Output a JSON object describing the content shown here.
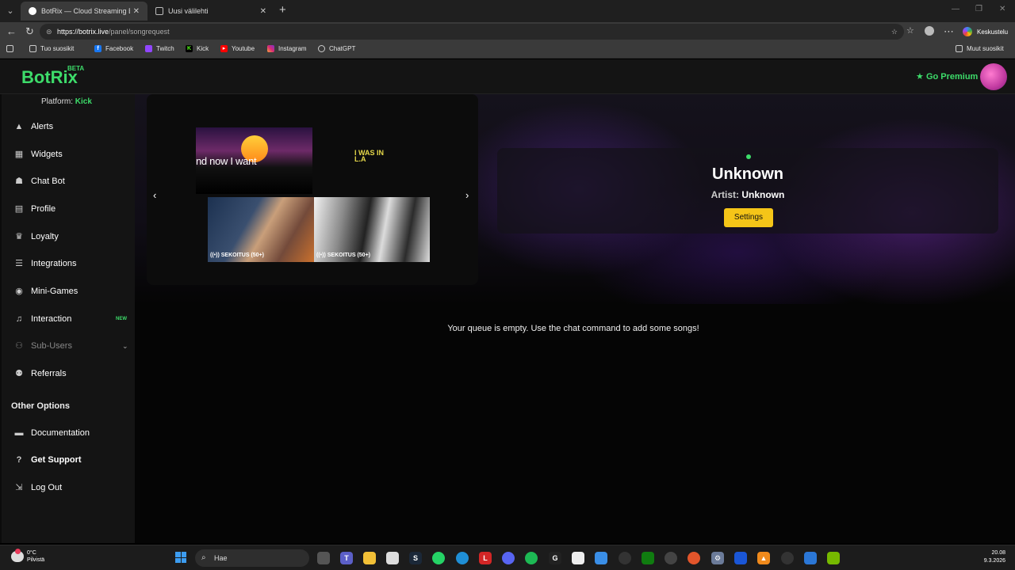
{
  "browser": {
    "tabs": [
      {
        "title": "BotRix — Cloud Streaming Bot for"
      },
      {
        "title": "Uusi välilehti"
      }
    ],
    "url_host": "https://botrix.live",
    "url_path": "/panel/songrequest",
    "profile_label": "Keskustelu",
    "bookmarks": [
      {
        "label": "Tuo suosikit"
      },
      {
        "label": "Facebook"
      },
      {
        "label": "Twitch"
      },
      {
        "label": "Kick"
      },
      {
        "label": "Youtube"
      },
      {
        "label": "Instagram"
      },
      {
        "label": "ChatGPT"
      }
    ],
    "other_bookmarks": "Muut suosikit"
  },
  "header": {
    "logo": "BotRix",
    "logo_badge": "BETA",
    "premium_label": "Go Premium"
  },
  "sidebar": {
    "platform_label": "Platform:",
    "platform_value": "Kick",
    "items": [
      {
        "label": "Alerts",
        "icon": "warning-icon"
      },
      {
        "label": "Widgets",
        "icon": "grid-icon"
      },
      {
        "label": "Chat Bot",
        "icon": "robot-icon"
      },
      {
        "label": "Profile",
        "icon": "id-card-icon"
      },
      {
        "label": "Loyalty",
        "icon": "trophy-icon"
      },
      {
        "label": "Integrations",
        "icon": "list-icon"
      },
      {
        "label": "Mini-Games",
        "icon": "gamepad-icon"
      },
      {
        "label": "Interaction",
        "icon": "music-icon",
        "badge": "NEW"
      },
      {
        "label": "Sub-Users",
        "icon": "users-icon"
      },
      {
        "label": "Referrals",
        "icon": "people-icon"
      }
    ],
    "other_title": "Other Options",
    "other_items": [
      {
        "label": "Documentation",
        "icon": "book-icon"
      },
      {
        "label": "Get Support",
        "icon": "support-icon"
      },
      {
        "label": "Log Out",
        "icon": "logout-icon"
      }
    ]
  },
  "carousel": {
    "lyric_text": "nd now I want",
    "small_thumb_text": "I WAS IN L.A",
    "videos": [
      {
        "caption": "SEKOITUS (50+)"
      },
      {
        "caption": "SEKOITUS (50+)"
      }
    ]
  },
  "now_playing": {
    "title": "Unknown",
    "artist_label": "Artist:",
    "artist": "Unknown",
    "settings_label": "Settings"
  },
  "queue": {
    "empty_message": "Your queue is empty. Use the chat command to add some songs!"
  },
  "taskbar": {
    "weather_temp": "0°C",
    "weather_desc": "Pilvistä",
    "search_placeholder": "Hae",
    "time": "20.08",
    "date": "9.3.2026"
  },
  "colors": {
    "accent": "#3ddc6a",
    "settings_button": "#f5c518"
  }
}
